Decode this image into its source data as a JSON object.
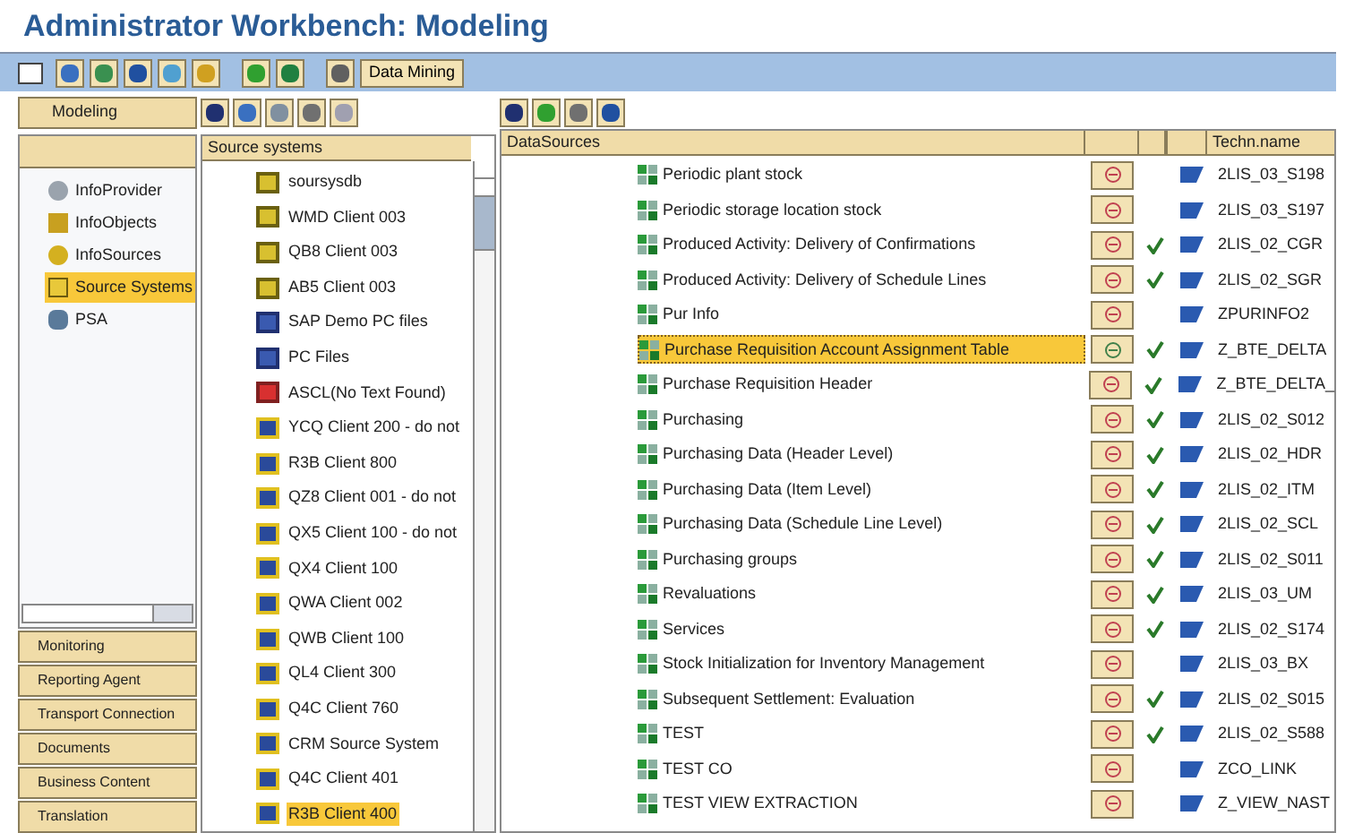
{
  "window": {
    "title": "Administrator Workbench: Modeling"
  },
  "toolbar": {
    "button": "Data Mining"
  },
  "nav": {
    "top": "Modeling",
    "items": [
      {
        "label": "InfoProvider",
        "kind": "provider",
        "selected": false
      },
      {
        "label": "InfoObjects",
        "kind": "objects",
        "selected": false
      },
      {
        "label": "InfoSources",
        "kind": "sources",
        "selected": false
      },
      {
        "label": "Source Systems",
        "kind": "systems",
        "selected": true
      },
      {
        "label": "PSA",
        "kind": "psa",
        "selected": false
      }
    ],
    "bottom": [
      "Monitoring",
      "Reporting Agent",
      "Transport Connection",
      "Documents",
      "Business Content",
      "Translation"
    ]
  },
  "source_systems": {
    "header": "Source systems",
    "items": [
      {
        "label": "soursysdb",
        "kind": "bw",
        "selected": false
      },
      {
        "label": "WMD Client 003",
        "kind": "bw",
        "selected": false
      },
      {
        "label": "QB8 Client 003",
        "kind": "bw",
        "selected": false
      },
      {
        "label": "AB5 Client 003",
        "kind": "bw",
        "selected": false
      },
      {
        "label": "SAP Demo PC files",
        "kind": "file",
        "selected": false
      },
      {
        "label": "PC Files",
        "kind": "file",
        "selected": false
      },
      {
        "label": "ASCL(No Text Found)",
        "kind": "error",
        "selected": false
      },
      {
        "label": "YCQ Client 200 - do not",
        "kind": "r3",
        "selected": false
      },
      {
        "label": "R3B Client 800",
        "kind": "r3",
        "selected": false
      },
      {
        "label": "QZ8 Client 001 - do not",
        "kind": "r3",
        "selected": false
      },
      {
        "label": "QX5 Client 100 - do not",
        "kind": "r3",
        "selected": false
      },
      {
        "label": "QX4 Client 100",
        "kind": "r3",
        "selected": false
      },
      {
        "label": "QWA Client 002",
        "kind": "r3",
        "selected": false
      },
      {
        "label": "QWB Client 100",
        "kind": "r3",
        "selected": false
      },
      {
        "label": "QL4 Client 300",
        "kind": "r3",
        "selected": false
      },
      {
        "label": "Q4C Client 760",
        "kind": "r3",
        "selected": false
      },
      {
        "label": "CRM Source System",
        "kind": "r3",
        "selected": false
      },
      {
        "label": "Q4C Client 401",
        "kind": "r3",
        "selected": false
      },
      {
        "label": "R3B Client 400",
        "kind": "r3",
        "selected": true
      }
    ]
  },
  "datasources": {
    "columns": [
      "DataSources",
      "Techn.name"
    ],
    "rows": [
      {
        "name": "Periodic plant stock",
        "expanded": true,
        "checked": false,
        "selected": false,
        "techn": "2LIS_03_S198"
      },
      {
        "name": "Periodic storage location stock",
        "expanded": true,
        "checked": false,
        "selected": false,
        "techn": "2LIS_03_S197"
      },
      {
        "name": "Produced Activity: Delivery of Confirmations",
        "expanded": true,
        "checked": true,
        "selected": false,
        "techn": "2LIS_02_CGR"
      },
      {
        "name": "Produced Activity: Delivery of Schedule Lines",
        "expanded": true,
        "checked": true,
        "selected": false,
        "techn": "2LIS_02_SGR"
      },
      {
        "name": "Pur Info",
        "expanded": true,
        "checked": false,
        "selected": false,
        "techn": "ZPURINFO2"
      },
      {
        "name": "Purchase Requisition Account Assignment Table",
        "expanded": false,
        "checked": true,
        "selected": true,
        "techn": "Z_BTE_DELTA"
      },
      {
        "name": "Purchase Requisition Header",
        "expanded": true,
        "checked": true,
        "selected": false,
        "techn": "Z_BTE_DELTA_"
      },
      {
        "name": "Purchasing",
        "expanded": true,
        "checked": true,
        "selected": false,
        "techn": "2LIS_02_S012"
      },
      {
        "name": "Purchasing Data (Header Level)",
        "expanded": true,
        "checked": true,
        "selected": false,
        "techn": "2LIS_02_HDR"
      },
      {
        "name": "Purchasing Data (Item Level)",
        "expanded": true,
        "checked": true,
        "selected": false,
        "techn": "2LIS_02_ITM"
      },
      {
        "name": "Purchasing Data (Schedule Line Level)",
        "expanded": true,
        "checked": true,
        "selected": false,
        "techn": "2LIS_02_SCL"
      },
      {
        "name": "Purchasing groups",
        "expanded": true,
        "checked": true,
        "selected": false,
        "techn": "2LIS_02_S011"
      },
      {
        "name": "Revaluations",
        "expanded": true,
        "checked": true,
        "selected": false,
        "techn": "2LIS_03_UM"
      },
      {
        "name": "Services",
        "expanded": true,
        "checked": true,
        "selected": false,
        "techn": "2LIS_02_S174"
      },
      {
        "name": "Stock Initialization for Inventory Management",
        "expanded": true,
        "checked": false,
        "selected": false,
        "techn": "2LIS_03_BX"
      },
      {
        "name": "Subsequent Settlement: Evaluation",
        "expanded": true,
        "checked": true,
        "selected": false,
        "techn": "2LIS_02_S015"
      },
      {
        "name": "TEST",
        "expanded": true,
        "checked": true,
        "selected": false,
        "techn": "2LIS_02_S588"
      },
      {
        "name": "TEST CO",
        "expanded": true,
        "checked": false,
        "selected": false,
        "techn": "ZCO_LINK"
      },
      {
        "name": "TEST VIEW EXTRACTION",
        "expanded": true,
        "checked": false,
        "selected": false,
        "techn": "Z_VIEW_NAST"
      }
    ]
  }
}
